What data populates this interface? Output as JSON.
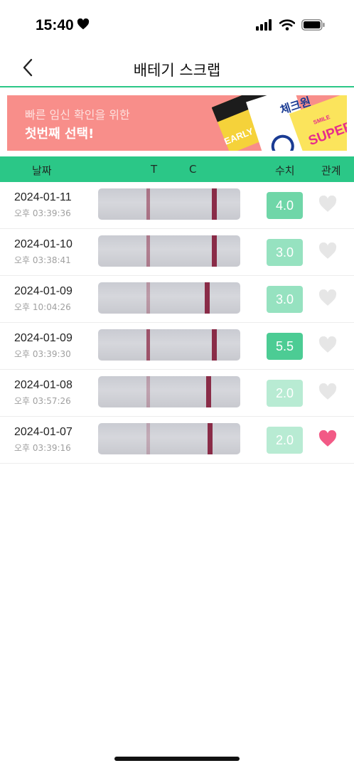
{
  "status_bar": {
    "time": "15:40"
  },
  "header": {
    "title": "배테기 스크랩"
  },
  "banner": {
    "line1": "빠른 임신 확인을 위한",
    "line2": "첫번째 선택!",
    "art_text_1": "EARLY TESTER",
    "art_text_2": "체크원",
    "art_text_3": "SUPER",
    "art_text_4": "SMILE"
  },
  "table": {
    "headers": {
      "date": "날짜",
      "t": "T",
      "c": "C",
      "value": "수치",
      "relation": "관계"
    },
    "rows": [
      {
        "date": "2024-01-11",
        "time": "오후 03:39:36",
        "value": "4.0",
        "badge_color": "#6fd6a8",
        "liked": false,
        "t_line": 0.34,
        "c_line": 0.8,
        "t_strength": 0.55
      },
      {
        "date": "2024-01-10",
        "time": "오후 03:38:41",
        "value": "3.0",
        "badge_color": "#96e2c0",
        "liked": false,
        "t_line": 0.34,
        "c_line": 0.8,
        "t_strength": 0.5
      },
      {
        "date": "2024-01-09",
        "time": "오후 10:04:26",
        "value": "3.0",
        "badge_color": "#96e2c0",
        "liked": false,
        "t_line": 0.34,
        "c_line": 0.75,
        "t_strength": 0.35
      },
      {
        "date": "2024-01-09",
        "time": "오후 03:39:30",
        "value": "5.5",
        "badge_color": "#4ccc94",
        "liked": false,
        "t_line": 0.34,
        "c_line": 0.8,
        "t_strength": 0.75
      },
      {
        "date": "2024-01-08",
        "time": "오후 03:57:26",
        "value": "2.0",
        "badge_color": "#b8ebd3",
        "liked": false,
        "t_line": 0.34,
        "c_line": 0.76,
        "t_strength": 0.3
      },
      {
        "date": "2024-01-07",
        "time": "오후 03:39:16",
        "value": "2.0",
        "badge_color": "#b8ebd3",
        "liked": true,
        "t_line": 0.34,
        "c_line": 0.77,
        "t_strength": 0.25
      }
    ]
  },
  "colors": {
    "accent": "#2bc787",
    "heart_on": "#f25a86",
    "heart_off": "#e6e6e6"
  }
}
